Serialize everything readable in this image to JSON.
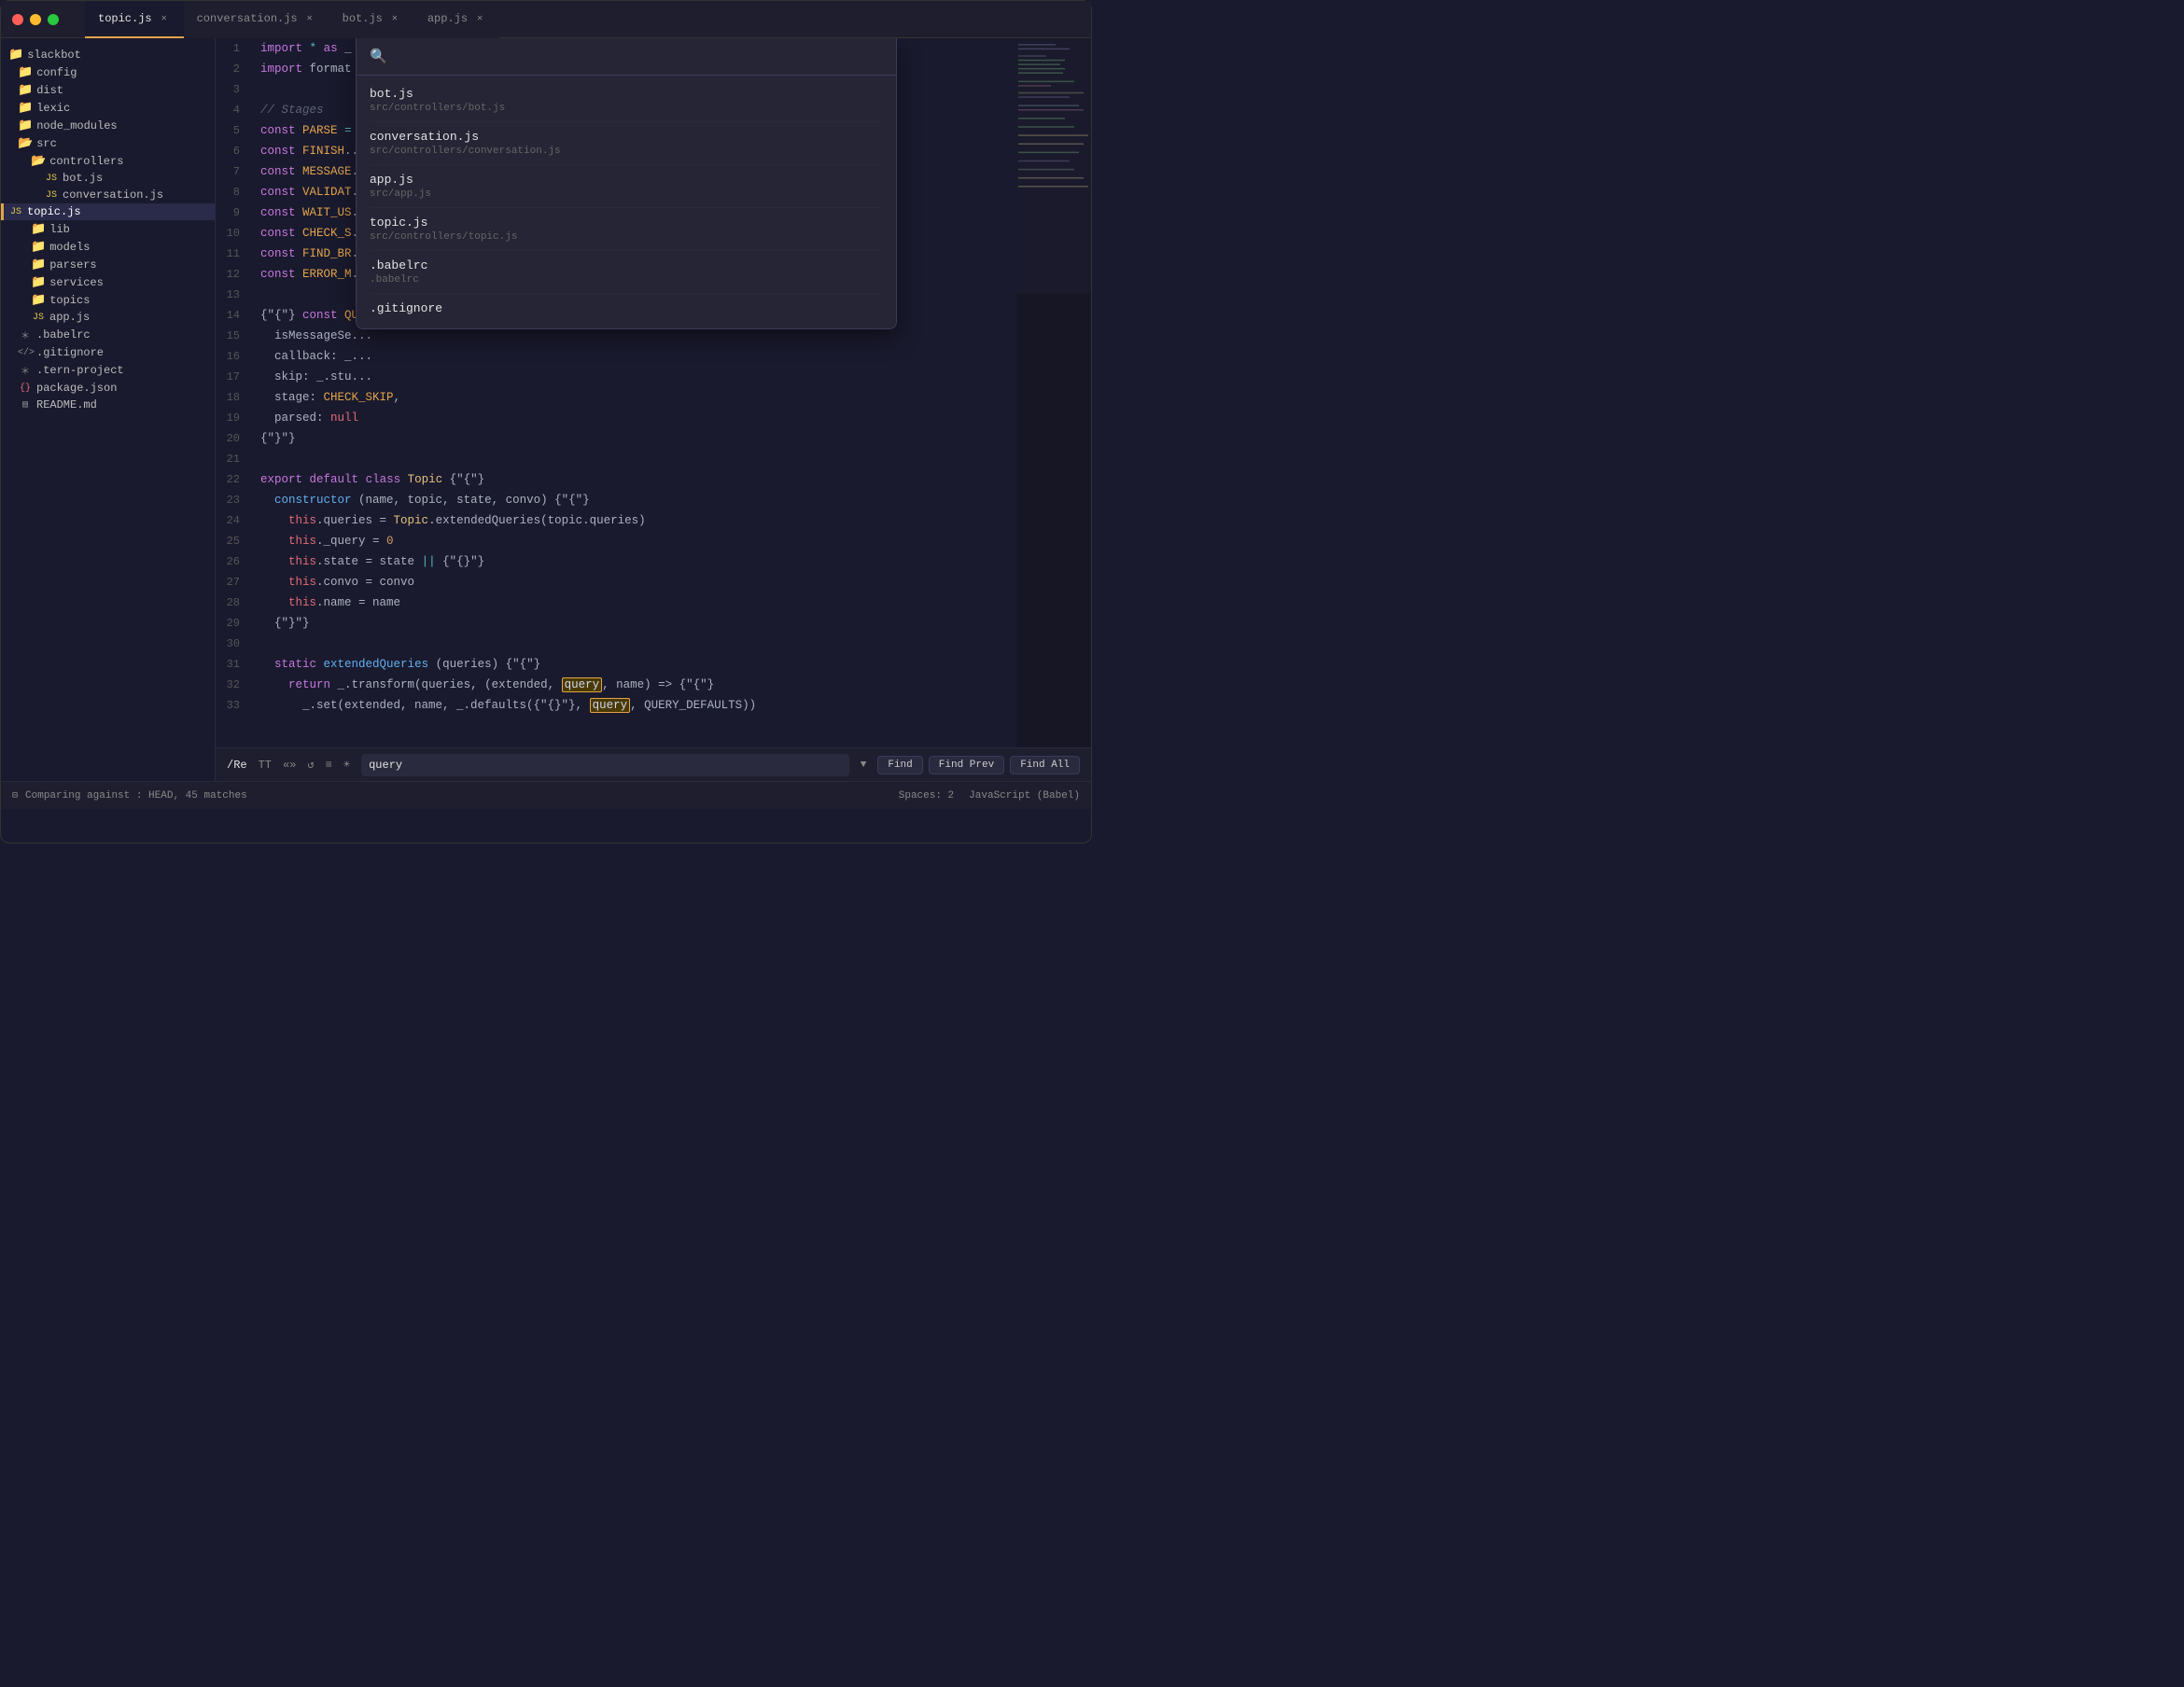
{
  "tabs": [
    {
      "id": "topic",
      "label": "topic.js",
      "active": true
    },
    {
      "id": "conversation",
      "label": "conversation.js",
      "active": false
    },
    {
      "id": "bot",
      "label": "bot.js",
      "active": false
    },
    {
      "id": "app",
      "label": "app.js",
      "active": false
    }
  ],
  "sidebar": {
    "root": "slackbot",
    "items": [
      {
        "label": "config",
        "type": "folder",
        "depth": 1
      },
      {
        "label": "dist",
        "type": "folder",
        "depth": 1
      },
      {
        "label": "lexic",
        "type": "folder",
        "depth": 1
      },
      {
        "label": "node_modules",
        "type": "folder",
        "depth": 1
      },
      {
        "label": "src",
        "type": "folder",
        "depth": 1,
        "open": true
      },
      {
        "label": "controllers",
        "type": "folder",
        "depth": 2,
        "open": true
      },
      {
        "label": "bot.js",
        "type": "file",
        "ext": "js",
        "depth": 3
      },
      {
        "label": "conversation.js",
        "type": "file",
        "ext": "js",
        "depth": 3
      },
      {
        "label": "topic.js",
        "type": "file",
        "ext": "js",
        "depth": 3,
        "active": true
      },
      {
        "label": "lib",
        "type": "folder",
        "depth": 2
      },
      {
        "label": "models",
        "type": "folder",
        "depth": 2
      },
      {
        "label": "parsers",
        "type": "folder",
        "depth": 2
      },
      {
        "label": "services",
        "type": "folder",
        "depth": 2
      },
      {
        "label": "topics",
        "type": "folder",
        "depth": 2
      },
      {
        "label": "app.js",
        "type": "file",
        "ext": "js",
        "depth": 2
      },
      {
        "label": ".babelrc",
        "type": "file",
        "ext": "ast",
        "depth": 1
      },
      {
        "label": ".gitignore",
        "type": "file",
        "ext": "git",
        "depth": 1
      },
      {
        "label": ".tern-project",
        "type": "file",
        "ext": "ast",
        "depth": 1
      },
      {
        "label": "package.json",
        "type": "file",
        "ext": "json",
        "depth": 1
      },
      {
        "label": "README.md",
        "type": "file",
        "ext": "md",
        "depth": 1
      }
    ]
  },
  "search_popup": {
    "placeholder": "",
    "results": [
      {
        "filename": "bot.js",
        "path": "src/controllers/bot.js"
      },
      {
        "filename": "conversation.js",
        "path": "src/controllers/conversation.js"
      },
      {
        "filename": "app.js",
        "path": "src/app.js"
      },
      {
        "filename": "topic.js",
        "path": "src/controllers/topic.js"
      },
      {
        "filename": ".babelrc",
        "path": ".babelrc"
      },
      {
        "filename": ".gitignore",
        "path": ".gitignore"
      }
    ]
  },
  "find_bar": {
    "search_term": "query",
    "regex_label": "/Re",
    "case_label": "TT",
    "word_label": "«»",
    "wrap_label": "↺",
    "preserve_label": "≡",
    "light_label": "☀",
    "find_button": "Find",
    "find_prev_button": "Find Prev",
    "find_all_button": "Find All"
  },
  "status_bar": {
    "git_label": "Comparing against : HEAD, 45 matches",
    "spaces_label": "Spaces: 2",
    "language_label": "JavaScript (Babel)"
  },
  "code": {
    "lines": [
      {
        "num": 1,
        "text": "import * as _ from 'lodash'"
      },
      {
        "num": 2,
        "text": "import format from 'lib/utils/format'"
      },
      {
        "num": 3,
        "text": ""
      },
      {
        "num": 4,
        "text": "// Stages"
      },
      {
        "num": 5,
        "text": "const PARSE = ..."
      },
      {
        "num": 6,
        "text": "const FINISH..."
      },
      {
        "num": 7,
        "text": "const MESSAGE..."
      },
      {
        "num": 8,
        "text": "const VALIDAT..."
      },
      {
        "num": 9,
        "text": "const WAIT_US..."
      },
      {
        "num": 10,
        "text": "const CHECK_S..."
      },
      {
        "num": 11,
        "text": "const FIND_BR..."
      },
      {
        "num": 12,
        "text": "const ERROR_M..."
      },
      {
        "num": 13,
        "text": ""
      },
      {
        "num": 14,
        "text": "const QUERY_D..."
      },
      {
        "num": 15,
        "text": "  isMessageSe..."
      },
      {
        "num": 16,
        "text": "  callback: _...."
      },
      {
        "num": 17,
        "text": "  skip: _.stu..."
      },
      {
        "num": 18,
        "text": "  stage: CHECK_SKIP,"
      },
      {
        "num": 19,
        "text": "  parsed: null"
      },
      {
        "num": 20,
        "text": "}"
      },
      {
        "num": 21,
        "text": ""
      },
      {
        "num": 22,
        "text": "export default class Topic {"
      },
      {
        "num": 23,
        "text": "  constructor (name, topic, state, convo) {"
      },
      {
        "num": 24,
        "text": "    this.queries = Topic.extendedQueries(topic.queries)"
      },
      {
        "num": 25,
        "text": "    this._query = 0"
      },
      {
        "num": 26,
        "text": "    this.state = state || {}"
      },
      {
        "num": 27,
        "text": "    this.convo = convo"
      },
      {
        "num": 28,
        "text": "    this.name = name"
      },
      {
        "num": 29,
        "text": "  }"
      },
      {
        "num": 30,
        "text": ""
      },
      {
        "num": 31,
        "text": "  static extendedQueries (queries) {"
      },
      {
        "num": 32,
        "text": "    return _.transform(queries, (extended, query, name) => {"
      },
      {
        "num": 33,
        "text": "      _.set(extended, name, _.defaults({}, query, QUERY_DEFAULTS))"
      }
    ]
  }
}
